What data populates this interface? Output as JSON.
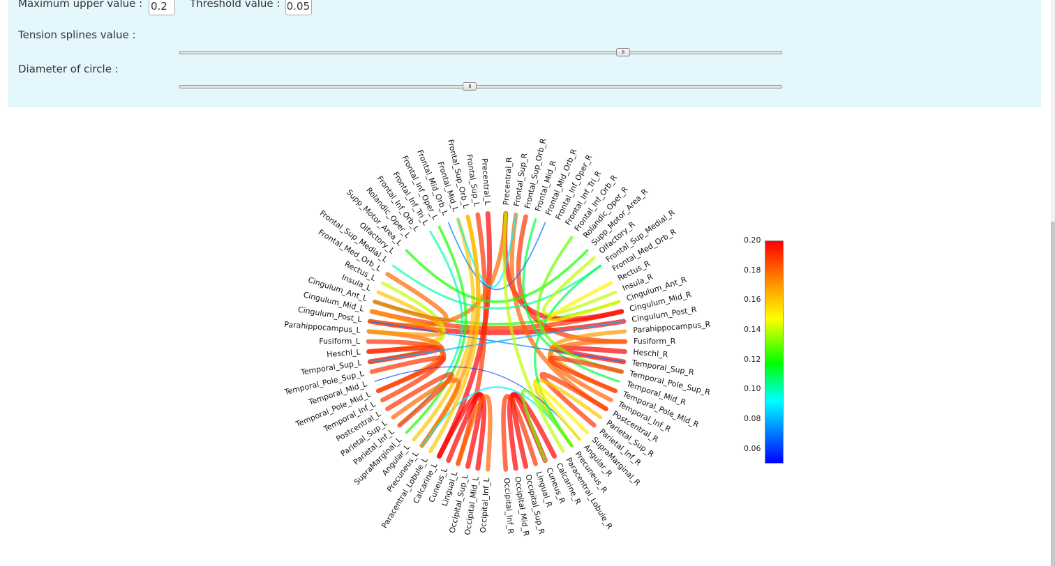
{
  "controls": {
    "max_upper_label": "Maximum upper value :",
    "max_upper_value": "0.2",
    "threshold_label": "Threshold value :",
    "threshold_value": "0.05",
    "tension_label": "Tension splines value :",
    "tension_slider_value": 0.74,
    "diameter_label": "Diameter of circle :",
    "diameter_slider_value": 0.48
  },
  "colorbar": {
    "min": 0.05,
    "max": 0.2,
    "ticks": [
      "0.20",
      "0.18",
      "0.16",
      "0.14",
      "0.12",
      "0.10",
      "0.08",
      "0.06"
    ],
    "colors": [
      "#ff0000",
      "#ff9900",
      "#ffff00",
      "#00ff00",
      "#00ffff",
      "#0000ff"
    ]
  },
  "chart_data": {
    "type": "chord",
    "nodes_left": [
      "Precentral_L",
      "Frontal_Sup_L",
      "Frontal_Sup_Orb_L",
      "Frontal_Mid_L",
      "Frontal_Mid_Orb_L",
      "Frontal_Inf_Oper_L",
      "Frontal_Inf_Tri_L",
      "Frontal_Inf_Orb_L",
      "Rolandic_Oper_L",
      "Supp_Motor_Area_L",
      "Olfactory_L",
      "Frontal_Sup_Medial_L",
      "Frontal_Med_Orb_L",
      "Rectus_L",
      "Insula_L",
      "Cingulum_Ant_L",
      "Cingulum_Mid_L",
      "Cingulum_Post_L",
      "Parahippocampus_L",
      "Fusiform_L",
      "Heschl_L",
      "Temporal_Sup_L",
      "Temporal_Pole_Sup_L",
      "Temporal_Mid_L",
      "Temporal_Pole_Mid_L",
      "Temporal_Inf_L",
      "Postcentral_L",
      "Parietal_Sup_L",
      "Parietal_Inf_L",
      "SupraMarginal_L",
      "Angular_L",
      "Precuneus_L",
      "Paracentral_Lobule_L",
      "Calcarine_L",
      "Cuneus_L",
      "Lingual_L",
      "Occipital_Sup_L",
      "Occipital_Mid_L",
      "Occipital_Inf_L"
    ],
    "nodes_right": [
      "Precentral_R",
      "Frontal_Sup_R",
      "Frontal_Sup_Orb_R",
      "Frontal_Mid_R",
      "Frontal_Mid_Orb_R",
      "Frontal_Inf_Oper_R",
      "Frontal_Inf_Tri_R",
      "Frontal_Inf_Orb_R",
      "Rolandic_Oper_R",
      "Supp_Motor_Area_R",
      "Olfactory_R",
      "Frontal_Sup_Medial_R",
      "Frontal_Med_Orb_R",
      "Rectus_R",
      "Insula_R",
      "Cingulum_Ant_R",
      "Cingulum_Mid_R",
      "Cingulum_Post_R",
      "Parahippocampus_R",
      "Fusiform_R",
      "Heschl_R",
      "Temporal_Sup_R",
      "Temporal_Pole_Sup_R",
      "Temporal_Mid_R",
      "Temporal_Pole_Mid_R",
      "Temporal_Inf_R",
      "Postcentral_R",
      "Parietal_Sup_R",
      "Parietal_Inf_R",
      "SupraMarginal_R",
      "Angular_R",
      "Precuneus_R",
      "Paracentral_Lobule_R",
      "Calcarine_R",
      "Cuneus_R",
      "Lingual_R",
      "Occipital_Sup_R",
      "Occipital_Mid_R",
      "Occipital_Inf_R"
    ],
    "links": [
      {
        "source": "Cingulum_Post_L",
        "target": "Cingulum_Post_R",
        "value": 0.2
      },
      {
        "source": "Cingulum_Mid_L",
        "target": "Cingulum_Mid_R",
        "value": 0.19
      },
      {
        "source": "Cingulum_Ant_L",
        "target": "Cingulum_Ant_R",
        "value": 0.12
      },
      {
        "source": "Precentral_L",
        "target": "Calcarine_L",
        "value": 0.2
      },
      {
        "source": "Frontal_Sup_L",
        "target": "Lingual_L",
        "value": 0.19
      },
      {
        "source": "Frontal_Sup_Orb_L",
        "target": "Precuneus_L",
        "value": 0.17
      },
      {
        "source": "Frontal_Mid_L",
        "target": "Angular_L",
        "value": 0.16
      },
      {
        "source": "Precentral_R",
        "target": "Cingulum_Mid_R",
        "value": 0.2
      },
      {
        "source": "Frontal_Sup_R",
        "target": "Postcentral_R",
        "value": 0.18
      },
      {
        "source": "Frontal_Sup_Orb_R",
        "target": "Fusiform_R",
        "value": 0.19
      },
      {
        "source": "Frontal_Mid_R",
        "target": "Temporal_Mid_R",
        "value": 0.11
      },
      {
        "source": "Precentral_R",
        "target": "Cingulum_Post_L",
        "value": 0.18
      },
      {
        "source": "Frontal_Sup_R",
        "target": "Frontal_Mid_L",
        "value": 0.09
      },
      {
        "source": "Frontal_Mid_Orb_R",
        "target": "Frontal_Mid_Orb_L",
        "value": 0.07
      },
      {
        "source": "Insula_L",
        "target": "Heschl_L",
        "value": 0.16
      },
      {
        "source": "Rectus_L",
        "target": "Temporal_Sup_L",
        "value": 0.14
      },
      {
        "source": "Frontal_Inf_Tri_L",
        "target": "Parietal_Inf_L",
        "value": 0.1
      },
      {
        "source": "Frontal_Inf_Oper_L",
        "target": "SupraMarginal_L",
        "value": 0.12
      },
      {
        "source": "Heschl_L",
        "target": "Temporal_Sup_L",
        "value": 0.2
      },
      {
        "source": "Fusiform_L",
        "target": "Temporal_Inf_L",
        "value": 0.19
      },
      {
        "source": "Parahippocampus_L",
        "target": "Temporal_Pole_Mid_L",
        "value": 0.18
      },
      {
        "source": "Heschl_R",
        "target": "Temporal_Sup_R",
        "value": 0.2
      },
      {
        "source": "Fusiform_R",
        "target": "Temporal_Inf_R",
        "value": 0.18
      },
      {
        "source": "Parahippocampus_R",
        "target": "Temporal_Pole_Mid_R",
        "value": 0.17
      },
      {
        "source": "Postcentral_L",
        "target": "Parietal_Inf_L",
        "value": 0.19
      },
      {
        "source": "Parietal_Sup_L",
        "target": "Precuneus_L",
        "value": 0.18
      },
      {
        "source": "Postcentral_R",
        "target": "Parietal_Inf_R",
        "value": 0.19
      },
      {
        "source": "Parietal_Sup_R",
        "target": "Precuneus_R",
        "value": 0.16
      },
      {
        "source": "Calcarine_L",
        "target": "Occipital_Mid_L",
        "value": 0.2
      },
      {
        "source": "Cuneus_L",
        "target": "Occipital_Sup_L",
        "value": 0.2
      },
      {
        "source": "Lingual_L",
        "target": "Occipital_Inf_L",
        "value": 0.18
      },
      {
        "source": "Calcarine_R",
        "target": "Occipital_Mid_R",
        "value": 0.2
      },
      {
        "source": "Cuneus_R",
        "target": "Occipital_Sup_R",
        "value": 0.2
      },
      {
        "source": "Lingual_R",
        "target": "Occipital_Inf_R",
        "value": 0.19
      },
      {
        "source": "Precuneus_L",
        "target": "Precuneus_R",
        "value": 0.09
      },
      {
        "source": "Temporal_Mid_L",
        "target": "Angular_R",
        "value": 0.06
      },
      {
        "source": "Cingulum_Post_L",
        "target": "Temporal_Sup_R",
        "value": 0.07
      },
      {
        "source": "Cingulum_Post_R",
        "target": "Temporal_Sup_L",
        "value": 0.08
      },
      {
        "source": "Frontal_Sup_Medial_L",
        "target": "Frontal_Sup_Medial_R",
        "value": 0.1
      },
      {
        "source": "Supp_Motor_Area_L",
        "target": "Supp_Motor_Area_R",
        "value": 0.12
      },
      {
        "source": "Frontal_Sup_Medial_R",
        "target": "Precuneus_R",
        "value": 0.11
      },
      {
        "source": "Olfactory_R",
        "target": "Insula_R",
        "value": 0.14
      },
      {
        "source": "Rectus_R",
        "target": "Cingulum_Ant_R",
        "value": 0.15
      },
      {
        "source": "Frontal_Inf_Orb_R",
        "target": "Temporal_Pole_Sup_R",
        "value": 0.13
      },
      {
        "source": "Cingulum_Mid_L",
        "target": "Parahippocampus_L",
        "value": 0.17
      },
      {
        "source": "Frontal_Med_Orb_L",
        "target": "Cingulum_Ant_L",
        "value": 0.18
      },
      {
        "source": "Temporal_Pole_Sup_L",
        "target": "Temporal_Pole_Mid_L",
        "value": 0.19
      },
      {
        "source": "Temporal_Pole_Sup_R",
        "target": "Temporal_Pole_Mid_R",
        "value": 0.19
      },
      {
        "source": "Angular_R",
        "target": "SupraMarginal_R",
        "value": 0.15
      },
      {
        "source": "Precuneus_R",
        "target": "Cuneus_R",
        "value": 0.13
      },
      {
        "source": "Paracentral_Lobule_R",
        "target": "Precentral_R",
        "value": 0.14
      },
      {
        "source": "Paracentral_Lobule_L",
        "target": "Frontal_Sup_Orb_L",
        "value": 0.16
      }
    ]
  }
}
